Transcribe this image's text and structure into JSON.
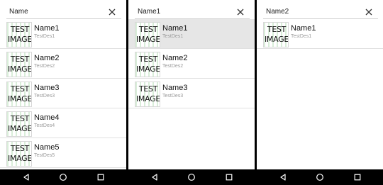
{
  "thumbnail_text": [
    "TEST",
    "IMAGE"
  ],
  "panels": [
    {
      "search_value": "Name",
      "items": [
        {
          "title": "Name1",
          "desc": "TestDes1"
        },
        {
          "title": "Name2",
          "desc": "TestDes2"
        },
        {
          "title": "Name3",
          "desc": "TestDes3"
        },
        {
          "title": "Name4",
          "desc": "TestDes4"
        },
        {
          "title": "Name5",
          "desc": "TestDes5"
        }
      ]
    },
    {
      "search_value": "Name1",
      "selected_index": 0,
      "items": [
        {
          "title": "Name1",
          "desc": "TestDes1"
        },
        {
          "title": "Name2",
          "desc": "TestDes2"
        },
        {
          "title": "Name3",
          "desc": "TestDes3"
        }
      ]
    },
    {
      "search_value": "Name2",
      "items": [
        {
          "title": "Name1",
          "desc": "TestDes1"
        }
      ]
    }
  ],
  "icons": {
    "clear": "close-icon",
    "nav_back": "back-triangle-icon",
    "nav_home": "home-circle-icon",
    "nav_recent": "recent-apps-square-icon"
  },
  "colors": {
    "selected_row": "#e6e6e6",
    "navbar": "#000000",
    "desc_text": "#9a9a9a"
  }
}
